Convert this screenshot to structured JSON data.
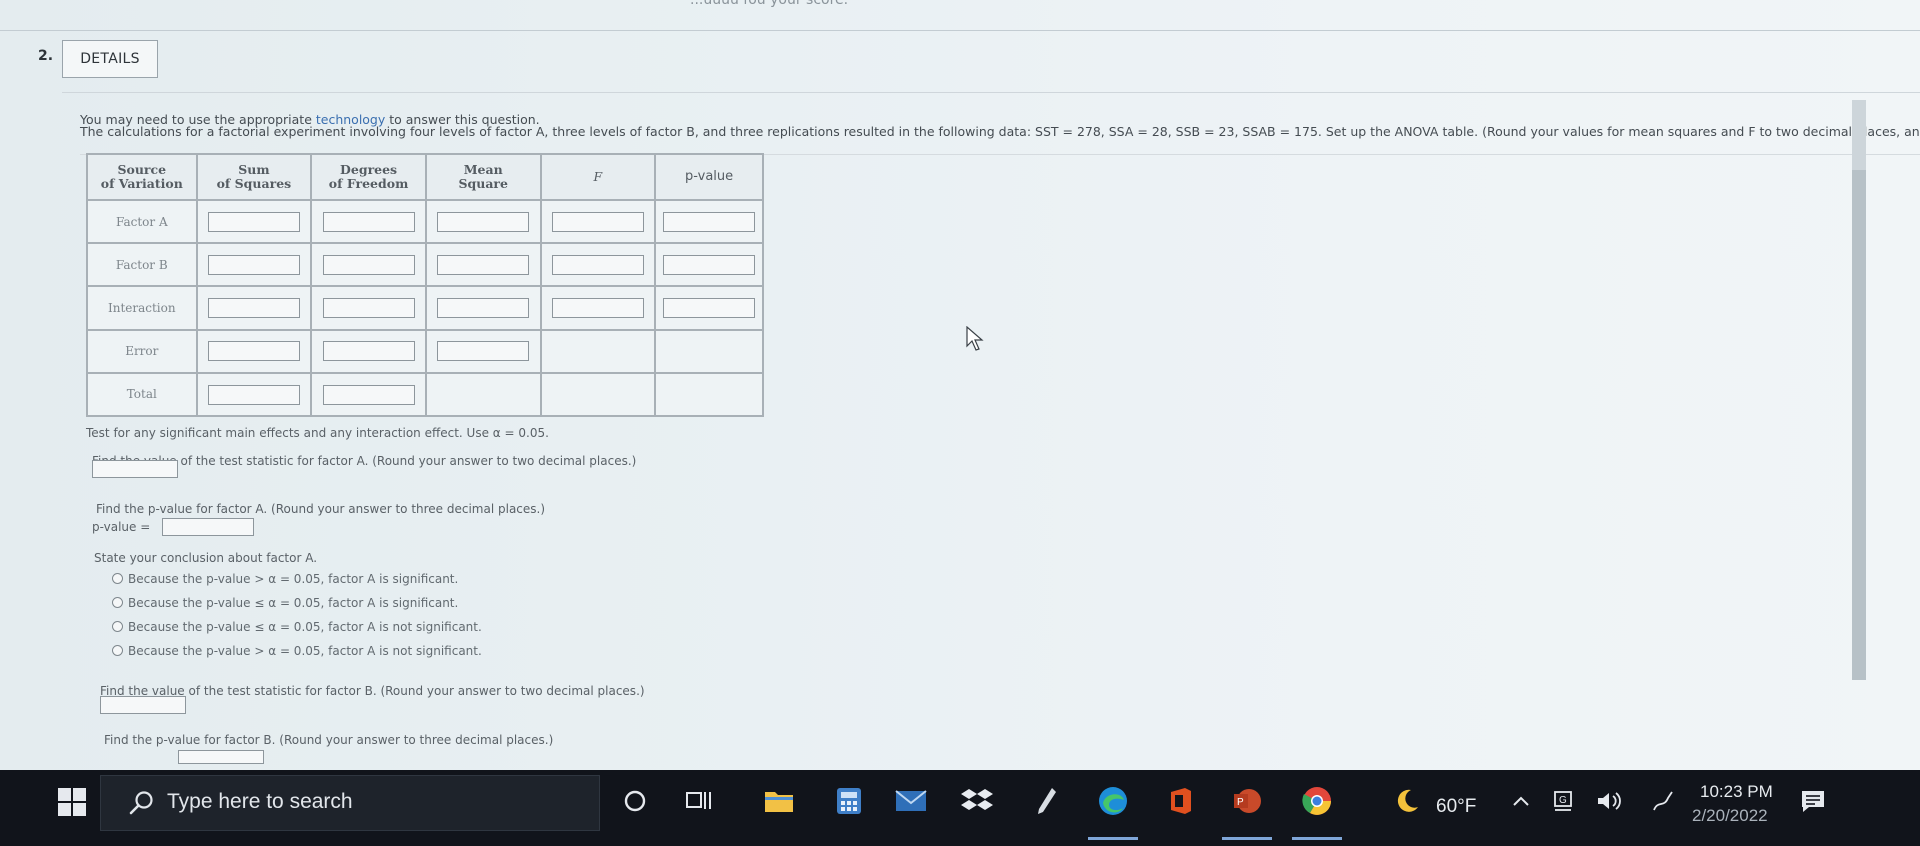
{
  "header": {
    "top_partial_text": "...uuuu fou your score.",
    "question_number": "2.",
    "details_label": "DETAILS"
  },
  "intro": {
    "line1_prefix": "You may need to use the appropriate ",
    "line1_link": "technology",
    "line1_suffix": " to answer this question.",
    "line2": "The calculations for a factorial experiment involving four levels of factor A, three levels of factor B, and three replications resulted in the following data: SST = 278, SSA = 28, SSB = 23, SSAB = 175. Set up the ANOVA table. (Round your values for mean squares and F to two decimal places, and y"
  },
  "table": {
    "headers": [
      "Source\nof Variation",
      "Sum\nof Squares",
      "Degrees\nof Freedom",
      "Mean\nSquare",
      "F",
      "p-value"
    ],
    "rows": [
      {
        "label": "Factor A",
        "inputs": [
          true,
          true,
          true,
          true,
          true
        ]
      },
      {
        "label": "Factor B",
        "inputs": [
          true,
          true,
          true,
          true,
          true
        ]
      },
      {
        "label": "Interaction",
        "inputs": [
          true,
          true,
          true,
          true,
          true
        ]
      },
      {
        "label": "Error",
        "inputs": [
          true,
          true,
          true,
          false,
          false
        ]
      },
      {
        "label": "Total",
        "inputs": [
          true,
          true,
          false,
          false,
          false
        ]
      }
    ]
  },
  "questions": {
    "test_instruction": "Test for any significant main effects and any interaction effect. Use α = 0.05.",
    "q_fa": "Find the value of the test statistic for factor A. (Round your answer to two decimal places.)",
    "q_pa": "Find the p-value for factor A. (Round your answer to three decimal places.)",
    "pvalue_label": "p-value =",
    "q_conclusion": "State your conclusion about factor A.",
    "options": [
      "Because the p-value > α = 0.05, factor A is significant.",
      "Because the p-value ≤ α = 0.05, factor A is significant.",
      "Because the p-value ≤ α = 0.05, factor A is not significant.",
      "Because the p-value > α = 0.05, factor A is not significant."
    ],
    "q_fb": "Find the value of the test statistic for factor B. (Round your answer to two decimal places.)",
    "q_pb": "Find the p-value for factor B. (Round your answer to three decimal places.)"
  },
  "taskbar": {
    "search_placeholder": "Type here to search",
    "weather": "60°F",
    "time": "10:23 PM",
    "date": "2/20/2022"
  }
}
